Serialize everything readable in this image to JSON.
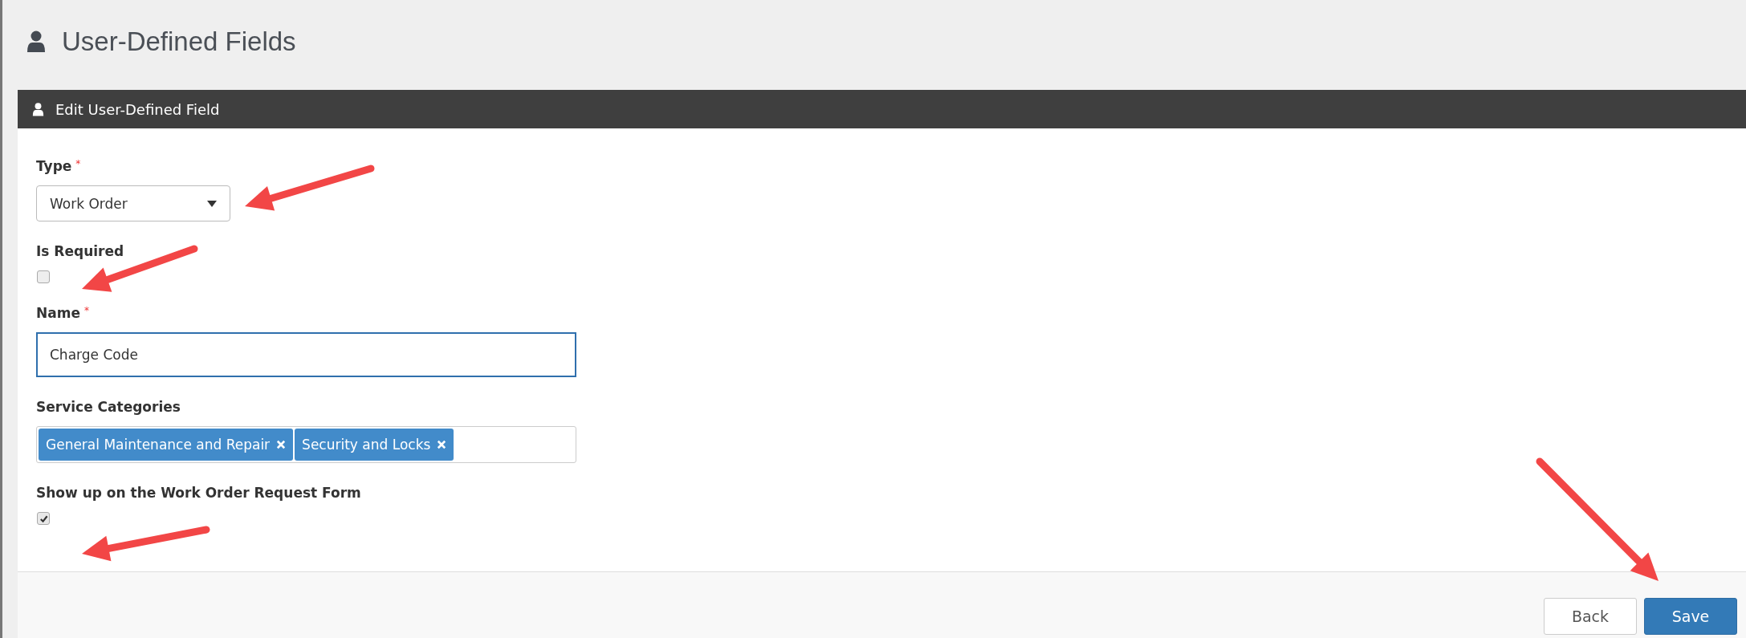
{
  "page_title": "User-Defined Fields",
  "panel": {
    "title": "Edit User-Defined Field",
    "fields": [
      {
        "kind": "select",
        "label": "Type",
        "required_mark": "*",
        "value": "Work Order"
      },
      {
        "kind": "checkbox",
        "label": "Is Required",
        "checked": false
      },
      {
        "kind": "text",
        "label": "Name",
        "required_mark": "*",
        "value": "Charge Code",
        "focused": true
      },
      {
        "kind": "tags",
        "label": "Service Categories",
        "tags": [
          "General Maintenance and Repair",
          "Security and Locks"
        ]
      },
      {
        "kind": "checkbox",
        "label": "Show up on the Work Order Request Form",
        "checked": true
      }
    ],
    "buttons": [
      {
        "label": "Back",
        "kind": "default"
      },
      {
        "label": "Save",
        "kind": "primary"
      }
    ]
  }
}
